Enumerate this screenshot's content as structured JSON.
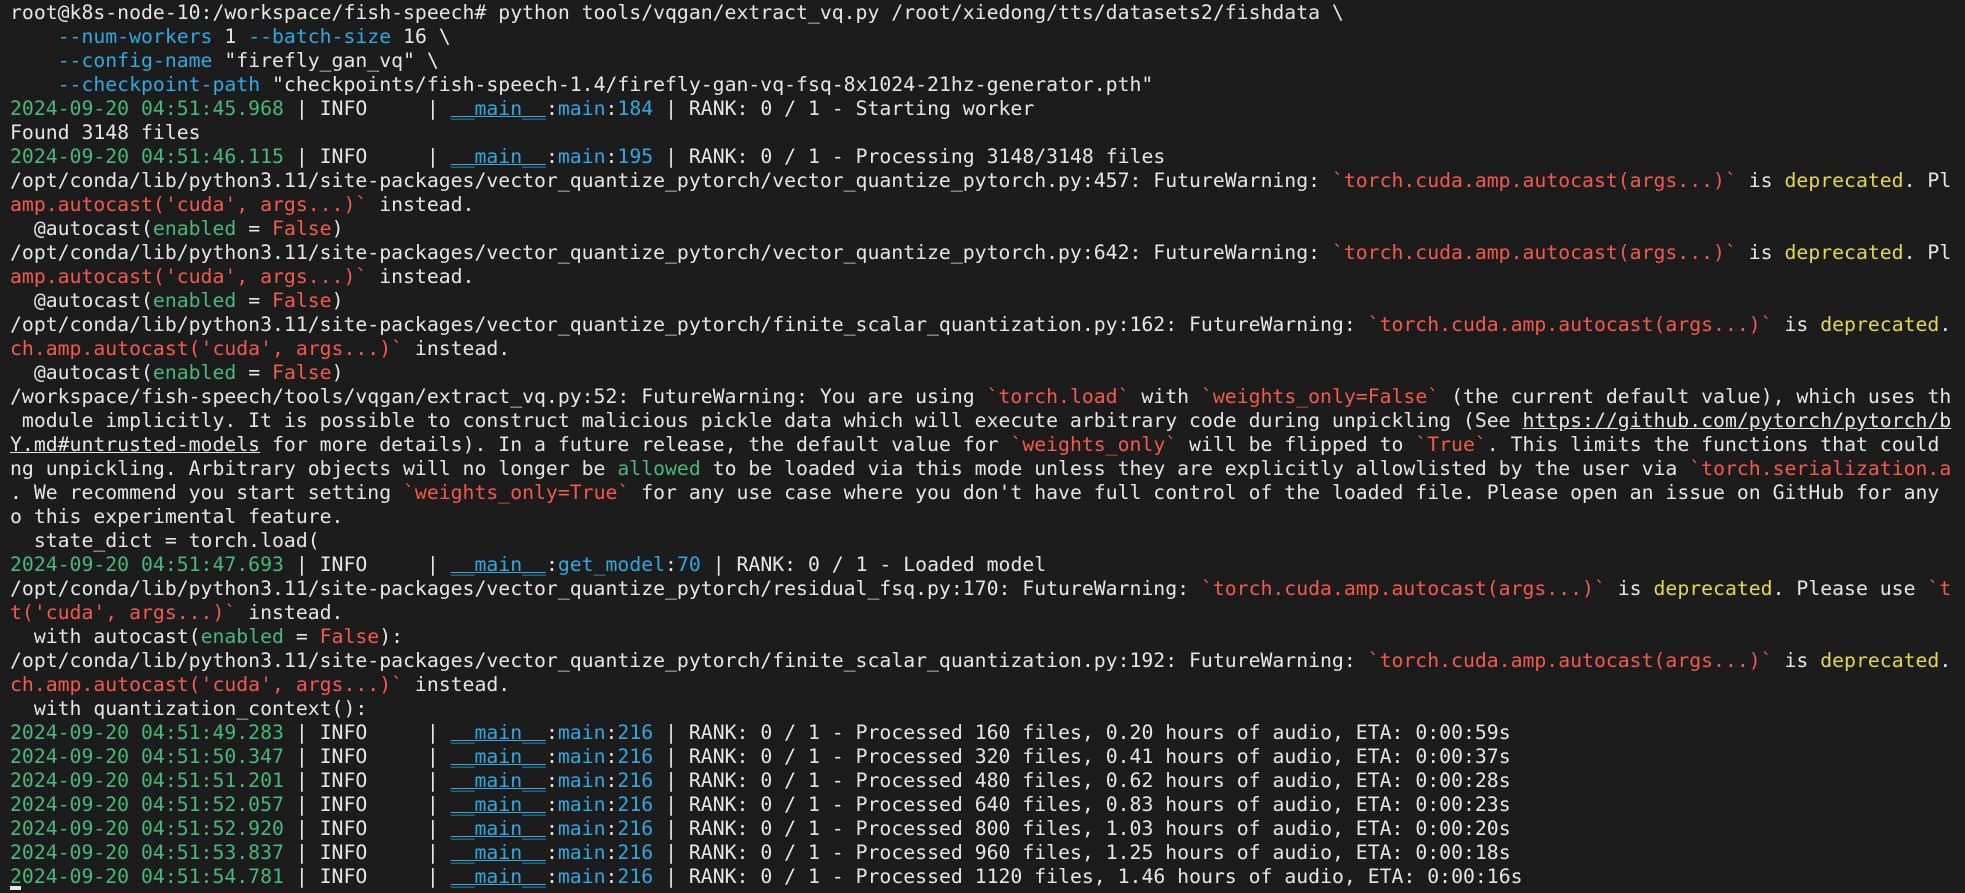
{
  "terminal": {
    "lines": [
      [
        {
          "t": "root@k8s-node-10:/workspace/fish-speech# python tools/vqgan/extract_vq.py /root/xiedong/tts/datasets2/fishdata \\",
          "c": "default"
        }
      ],
      [
        {
          "t": "    ",
          "c": "default"
        },
        {
          "t": "--num-workers",
          "c": "cyan"
        },
        {
          "t": " 1 ",
          "c": "default"
        },
        {
          "t": "--batch-size",
          "c": "cyan"
        },
        {
          "t": " 16 \\",
          "c": "default"
        }
      ],
      [
        {
          "t": "    ",
          "c": "default"
        },
        {
          "t": "--config-name",
          "c": "cyan"
        },
        {
          "t": " \"firefly_gan_vq\" \\",
          "c": "default"
        }
      ],
      [
        {
          "t": "    ",
          "c": "default"
        },
        {
          "t": "--checkpoint-path",
          "c": "cyan"
        },
        {
          "t": " \"checkpoints/fish-speech-1.4/firefly-gan-vq-fsq-8x1024-21hz-generator.pth\"",
          "c": "default"
        }
      ],
      [
        {
          "t": "2024-09-20 04:51:45.968",
          "c": "green"
        },
        {
          "t": " | INFO     | ",
          "c": "default"
        },
        {
          "t": "__main__",
          "c": "cyan",
          "u": true
        },
        {
          "t": ":",
          "c": "default"
        },
        {
          "t": "main",
          "c": "cyan"
        },
        {
          "t": ":",
          "c": "default"
        },
        {
          "t": "184",
          "c": "cyan"
        },
        {
          "t": " | RANK: 0 / 1 - Starting worker",
          "c": "default"
        }
      ],
      [
        {
          "t": "Found 3148 files",
          "c": "default"
        }
      ],
      [
        {
          "t": "2024-09-20 04:51:46.115",
          "c": "green"
        },
        {
          "t": " | INFO     | ",
          "c": "default"
        },
        {
          "t": "__main__",
          "c": "cyan",
          "u": true
        },
        {
          "t": ":",
          "c": "default"
        },
        {
          "t": "main",
          "c": "cyan"
        },
        {
          "t": ":",
          "c": "default"
        },
        {
          "t": "195",
          "c": "cyan"
        },
        {
          "t": " | RANK: 0 / 1 - Processing 3148/3148 files",
          "c": "default"
        }
      ],
      [
        {
          "t": "/opt/conda/lib/python3.11/site-packages/vector_quantize_pytorch/vector_quantize_pytorch.py:457: FutureWarning: ",
          "c": "default"
        },
        {
          "t": "`torch.cuda.amp.autocast(args...)`",
          "c": "red"
        },
        {
          "t": " is ",
          "c": "default"
        },
        {
          "t": "deprecated",
          "c": "yellow"
        },
        {
          "t": ". Pl",
          "c": "default"
        }
      ],
      [
        {
          "t": "amp.autocast('cuda', args...)`",
          "c": "red"
        },
        {
          "t": " instead.",
          "c": "default"
        }
      ],
      [
        {
          "t": "  @autocast(",
          "c": "default"
        },
        {
          "t": "enabled",
          "c": "green"
        },
        {
          "t": " = ",
          "c": "default"
        },
        {
          "t": "False",
          "c": "red"
        },
        {
          "t": ")",
          "c": "default"
        }
      ],
      [
        {
          "t": "/opt/conda/lib/python3.11/site-packages/vector_quantize_pytorch/vector_quantize_pytorch.py:642: FutureWarning: ",
          "c": "default"
        },
        {
          "t": "`torch.cuda.amp.autocast(args...)`",
          "c": "red"
        },
        {
          "t": " is ",
          "c": "default"
        },
        {
          "t": "deprecated",
          "c": "yellow"
        },
        {
          "t": ". Pl",
          "c": "default"
        }
      ],
      [
        {
          "t": "amp.autocast('cuda', args...)`",
          "c": "red"
        },
        {
          "t": " instead.",
          "c": "default"
        }
      ],
      [
        {
          "t": "  @autocast(",
          "c": "default"
        },
        {
          "t": "enabled",
          "c": "green"
        },
        {
          "t": " = ",
          "c": "default"
        },
        {
          "t": "False",
          "c": "red"
        },
        {
          "t": ")",
          "c": "default"
        }
      ],
      [
        {
          "t": "/opt/conda/lib/python3.11/site-packages/vector_quantize_pytorch/finite_scalar_quantization.py:162: FutureWarning: ",
          "c": "default"
        },
        {
          "t": "`torch.cuda.amp.autocast(args...)`",
          "c": "red"
        },
        {
          "t": " is ",
          "c": "default"
        },
        {
          "t": "deprecated",
          "c": "yellow"
        },
        {
          "t": ".",
          "c": "default"
        }
      ],
      [
        {
          "t": "ch.amp.autocast('cuda', args...)`",
          "c": "red"
        },
        {
          "t": " instead.",
          "c": "default"
        }
      ],
      [
        {
          "t": "  @autocast(",
          "c": "default"
        },
        {
          "t": "enabled",
          "c": "green"
        },
        {
          "t": " = ",
          "c": "default"
        },
        {
          "t": "False",
          "c": "red"
        },
        {
          "t": ")",
          "c": "default"
        }
      ],
      [
        {
          "t": "/workspace/fish-speech/tools/vqgan/extract_vq.py:52: FutureWarning: You are using ",
          "c": "default"
        },
        {
          "t": "`torch.load`",
          "c": "red"
        },
        {
          "t": " with ",
          "c": "default"
        },
        {
          "t": "`weights_only=False`",
          "c": "red"
        },
        {
          "t": " (the current default value), which uses th",
          "c": "default"
        }
      ],
      [
        {
          "t": " module implicitly. It is possible to construct malicious pickle data which will execute arbitrary code during unpickling (See ",
          "c": "default"
        },
        {
          "t": "https://github.com/pytorch/pytorch/b",
          "c": "link"
        }
      ],
      [
        {
          "t": "Y.md#untrusted-models",
          "c": "link"
        },
        {
          "t": " for more details). In a future release, the default value for ",
          "c": "default"
        },
        {
          "t": "`weights_only`",
          "c": "red"
        },
        {
          "t": " will be flipped to ",
          "c": "default"
        },
        {
          "t": "`True`",
          "c": "red"
        },
        {
          "t": ". This limits the functions that could",
          "c": "default"
        }
      ],
      [
        {
          "t": "ng unpickling. Arbitrary objects will no longer be ",
          "c": "default"
        },
        {
          "t": "allowed",
          "c": "green"
        },
        {
          "t": " to be loaded via this mode unless they are explicitly allowlisted by the user via ",
          "c": "default"
        },
        {
          "t": "`torch.serialization.a",
          "c": "red"
        }
      ],
      [
        {
          "t": ". We recommend you start setting ",
          "c": "default"
        },
        {
          "t": "`weights_only=True`",
          "c": "red"
        },
        {
          "t": " for any use case where you don't have full control of the loaded file. Please open an issue on GitHub for any",
          "c": "default"
        }
      ],
      [
        {
          "t": "o this experimental feature.",
          "c": "default"
        }
      ],
      [
        {
          "t": "  state_dict = torch.load(",
          "c": "default"
        }
      ],
      [
        {
          "t": "2024-09-20 04:51:47.693",
          "c": "green"
        },
        {
          "t": " | INFO     | ",
          "c": "default"
        },
        {
          "t": "__main__",
          "c": "cyan",
          "u": true
        },
        {
          "t": ":",
          "c": "default"
        },
        {
          "t": "get_model",
          "c": "cyan"
        },
        {
          "t": ":",
          "c": "default"
        },
        {
          "t": "70",
          "c": "cyan"
        },
        {
          "t": " | RANK: 0 / 1 - Loaded model",
          "c": "default"
        }
      ],
      [
        {
          "t": "/opt/conda/lib/python3.11/site-packages/vector_quantize_pytorch/residual_fsq.py:170: FutureWarning: ",
          "c": "default"
        },
        {
          "t": "`torch.cuda.amp.autocast(args...)`",
          "c": "red"
        },
        {
          "t": " is ",
          "c": "default"
        },
        {
          "t": "deprecated",
          "c": "yellow"
        },
        {
          "t": ". Please use ",
          "c": "default"
        },
        {
          "t": "`t",
          "c": "red"
        }
      ],
      [
        {
          "t": "t('cuda', args...)`",
          "c": "red"
        },
        {
          "t": " instead.",
          "c": "default"
        }
      ],
      [
        {
          "t": "  with autocast(",
          "c": "default"
        },
        {
          "t": "enabled",
          "c": "green"
        },
        {
          "t": " = ",
          "c": "default"
        },
        {
          "t": "False",
          "c": "red"
        },
        {
          "t": "):",
          "c": "default"
        }
      ],
      [
        {
          "t": "/opt/conda/lib/python3.11/site-packages/vector_quantize_pytorch/finite_scalar_quantization.py:192: FutureWarning: ",
          "c": "default"
        },
        {
          "t": "`torch.cuda.amp.autocast(args...)`",
          "c": "red"
        },
        {
          "t": " is ",
          "c": "default"
        },
        {
          "t": "deprecated",
          "c": "yellow"
        },
        {
          "t": ".",
          "c": "default"
        }
      ],
      [
        {
          "t": "ch.amp.autocast('cuda', args...)`",
          "c": "red"
        },
        {
          "t": " instead.",
          "c": "default"
        }
      ],
      [
        {
          "t": "  with quantization_context():",
          "c": "default"
        }
      ],
      [
        {
          "t": "2024-09-20 04:51:49.283",
          "c": "green"
        },
        {
          "t": " | INFO     | ",
          "c": "default"
        },
        {
          "t": "__main__",
          "c": "cyan",
          "u": true
        },
        {
          "t": ":",
          "c": "default"
        },
        {
          "t": "main",
          "c": "cyan"
        },
        {
          "t": ":",
          "c": "default"
        },
        {
          "t": "216",
          "c": "cyan"
        },
        {
          "t": " | RANK: 0 / 1 - Processed 160 files, 0.20 hours of audio, ETA: 0:00:59s",
          "c": "default"
        }
      ],
      [
        {
          "t": "2024-09-20 04:51:50.347",
          "c": "green"
        },
        {
          "t": " | INFO     | ",
          "c": "default"
        },
        {
          "t": "__main__",
          "c": "cyan",
          "u": true
        },
        {
          "t": ":",
          "c": "default"
        },
        {
          "t": "main",
          "c": "cyan"
        },
        {
          "t": ":",
          "c": "default"
        },
        {
          "t": "216",
          "c": "cyan"
        },
        {
          "t": " | RANK: 0 / 1 - Processed 320 files, 0.41 hours of audio, ETA: 0:00:37s",
          "c": "default"
        }
      ],
      [
        {
          "t": "2024-09-20 04:51:51.201",
          "c": "green"
        },
        {
          "t": " | INFO     | ",
          "c": "default"
        },
        {
          "t": "__main__",
          "c": "cyan",
          "u": true
        },
        {
          "t": ":",
          "c": "default"
        },
        {
          "t": "main",
          "c": "cyan"
        },
        {
          "t": ":",
          "c": "default"
        },
        {
          "t": "216",
          "c": "cyan"
        },
        {
          "t": " | RANK: 0 / 1 - Processed 480 files, 0.62 hours of audio, ETA: 0:00:28s",
          "c": "default"
        }
      ],
      [
        {
          "t": "2024-09-20 04:51:52.057",
          "c": "green"
        },
        {
          "t": " | INFO     | ",
          "c": "default"
        },
        {
          "t": "__main__",
          "c": "cyan",
          "u": true
        },
        {
          "t": ":",
          "c": "default"
        },
        {
          "t": "main",
          "c": "cyan"
        },
        {
          "t": ":",
          "c": "default"
        },
        {
          "t": "216",
          "c": "cyan"
        },
        {
          "t": " | RANK: 0 / 1 - Processed 640 files, 0.83 hours of audio, ETA: 0:00:23s",
          "c": "default"
        }
      ],
      [
        {
          "t": "2024-09-20 04:51:52.920",
          "c": "green"
        },
        {
          "t": " | INFO     | ",
          "c": "default"
        },
        {
          "t": "__main__",
          "c": "cyan",
          "u": true
        },
        {
          "t": ":",
          "c": "default"
        },
        {
          "t": "main",
          "c": "cyan"
        },
        {
          "t": ":",
          "c": "default"
        },
        {
          "t": "216",
          "c": "cyan"
        },
        {
          "t": " | RANK: 0 / 1 - Processed 800 files, 1.03 hours of audio, ETA: 0:00:20s",
          "c": "default"
        }
      ],
      [
        {
          "t": "2024-09-20 04:51:53.837",
          "c": "green"
        },
        {
          "t": " | INFO     | ",
          "c": "default"
        },
        {
          "t": "__main__",
          "c": "cyan",
          "u": true
        },
        {
          "t": ":",
          "c": "default"
        },
        {
          "t": "main",
          "c": "cyan"
        },
        {
          "t": ":",
          "c": "default"
        },
        {
          "t": "216",
          "c": "cyan"
        },
        {
          "t": " | RANK: 0 / 1 - Processed 960 files, 1.25 hours of audio, ETA: 0:00:18s",
          "c": "default"
        }
      ],
      [
        {
          "t": "2024-09-20 04:51:54.781",
          "c": "green"
        },
        {
          "t": " | INFO     | ",
          "c": "default"
        },
        {
          "t": "__main__",
          "c": "cyan",
          "u": true
        },
        {
          "t": ":",
          "c": "default"
        },
        {
          "t": "main",
          "c": "cyan"
        },
        {
          "t": ":",
          "c": "default"
        },
        {
          "t": "216",
          "c": "cyan"
        },
        {
          "t": " | RANK: 0 / 1 - Processed 1120 files, 1.46 hours of audio, ETA: 0:00:16s",
          "c": "default"
        }
      ]
    ]
  },
  "colors": {
    "background": "#1c1c1c",
    "default": "#e6e6e6",
    "green": "#46b97b",
    "cyan": "#2fa9df",
    "red": "#f25a4e",
    "yellow": "#e6d84c"
  }
}
